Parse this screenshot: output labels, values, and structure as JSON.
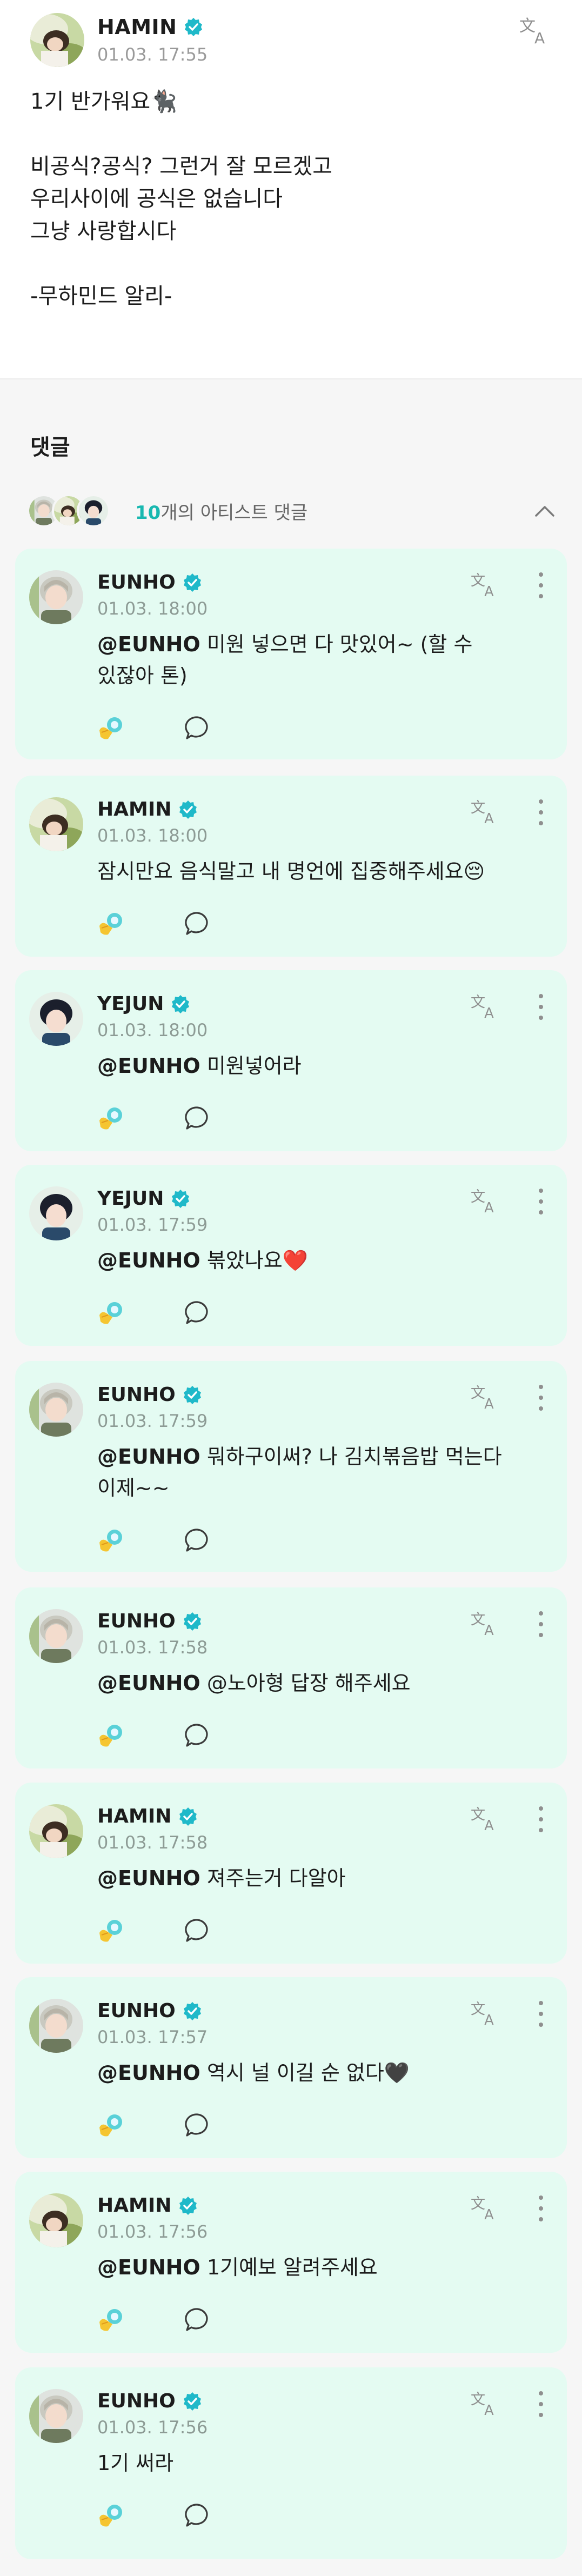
{
  "post": {
    "author": "HAMIN",
    "time": "01.03. 17:55",
    "body": "1기 반가워요🐈‍⬛\n\n비공식?공식? 그런거 잘 모르겠고\n우리사이에 공식은 없습니다\n그냥 사랑합시다\n\n-무하민드 알리-",
    "icons": {
      "translate": "translate-icon",
      "verified": "verified-badge-icon",
      "avatar": "avatar"
    }
  },
  "comments_section": {
    "title": "댓글",
    "artist_count": "10",
    "artist_label": "개의 아티스트 댓글"
  },
  "colors": {
    "card_bg": "#e4fbf2",
    "accent": "#19b8b0",
    "verified": "#1fb9c9"
  },
  "comments": [
    {
      "author": "EUNHO",
      "time": "01.03. 18:00",
      "mention": "@EUNHO",
      "text": " 미원 넣으면 다 맛있어~ (할 수 있잖아 톤)"
    },
    {
      "author": "HAMIN",
      "time": "01.03. 18:00",
      "mention": "",
      "text": "잠시만요 음식말고 내 명언에 집중해주세요😔"
    },
    {
      "author": "YEJUN",
      "time": "01.03. 18:00",
      "mention": "@EUNHO",
      "text": " 미원넣어라"
    },
    {
      "author": "YEJUN",
      "time": "01.03. 17:59",
      "mention": "@EUNHO",
      "text": " 볶았나요❤️"
    },
    {
      "author": "EUNHO",
      "time": "01.03. 17:59",
      "mention": "@EUNHO",
      "text": " 뭐하구이써? 나 김치볶음밥 먹는다 이제~~"
    },
    {
      "author": "EUNHO",
      "time": "01.03. 17:58",
      "mention": "@EUNHO",
      "text": " @노아형 답장 해주세요"
    },
    {
      "author": "HAMIN",
      "time": "01.03. 17:58",
      "mention": "@EUNHO",
      "text": " 져주는거 다알아"
    },
    {
      "author": "EUNHO",
      "time": "01.03. 17:57",
      "mention": "@EUNHO",
      "text": " 역시 널 이길 순 없다🖤"
    },
    {
      "author": "HAMIN",
      "time": "01.03. 17:56",
      "mention": "@EUNHO",
      "text": " 1기예보 알려주세요"
    },
    {
      "author": "EUNHO",
      "time": "01.03. 17:56",
      "mention": "",
      "text": "1기 써라"
    }
  ]
}
